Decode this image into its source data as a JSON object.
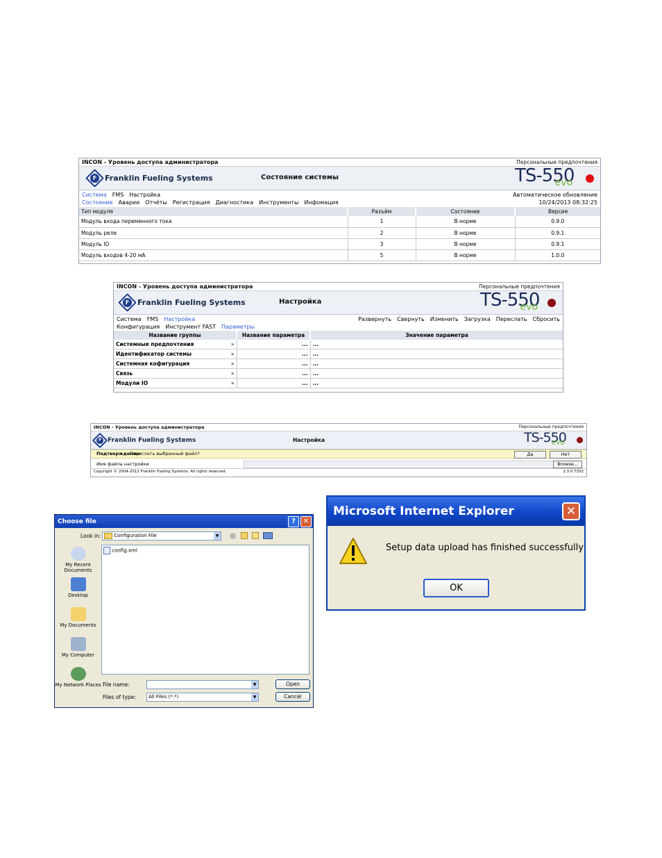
{
  "shot1": {
    "top_title": "INCON - Уровень доступа администратора",
    "pref": "Персональные предпочтения",
    "logo": "Franklin Fueling Systems",
    "header_title": "Состояние системы",
    "brand": "TS-550",
    "brand_sub": "evo",
    "menu1": [
      "Система",
      "FMS",
      "Настройка"
    ],
    "auto_update": "Автоматическое обновление",
    "menu2": [
      "Состояние",
      "Аварии",
      "Отчёты",
      "Регистрация",
      "Диагностика",
      "Инструменты",
      "Инфомация"
    ],
    "datetime": "10/24/2013 08:32:25",
    "columns": [
      "Тип модуля",
      "Разъём",
      "Состояние",
      "Версия"
    ],
    "rows": [
      [
        "Модуль входа переменного тока",
        "1",
        "В норме",
        "0.9.0"
      ],
      [
        "Модуль реле",
        "2",
        "В норме",
        "0.9.1"
      ],
      [
        "Модуль IO",
        "3",
        "В норме",
        "0.9.1"
      ],
      [
        "Модуль входов 4-20 мА",
        "5",
        "В норме",
        "1.0.0"
      ]
    ]
  },
  "shot2": {
    "top_title": "INCON - Уровень доступа администратора",
    "pref": "Персональные предпочтения",
    "logo": "Franklin Fueling Systems",
    "header_title": "Настройка",
    "brand": "TS-550",
    "brand_sub": "evo",
    "menu1": [
      "Система",
      "FMS",
      "Настройка"
    ],
    "actions": [
      "Развернуть",
      "Свернуть",
      "Изменить",
      "Загрузка",
      "Переслать",
      "Сбросить"
    ],
    "menu2": [
      "Конфигурация",
      "Инструмент FAST",
      "Параметры"
    ],
    "columns": [
      "Название группы",
      "Название параметра",
      "Значение параметра"
    ],
    "rows": [
      [
        "Системные предпочтения",
        "»",
        "...",
        "..."
      ],
      [
        "Идентификатор системы",
        "»",
        "...",
        "..."
      ],
      [
        "Системная кофигурация",
        "»",
        "...",
        "..."
      ],
      [
        "Связь",
        "»",
        "...",
        "..."
      ],
      [
        "Модули IO",
        "»",
        "...",
        "..."
      ]
    ]
  },
  "shot3": {
    "top_title": "INCON - Уровень доступа администратора",
    "pref": "Персональные предпочтения",
    "logo": "Franklin Fueling Systems",
    "header_title": "Настройка",
    "brand": "TS-550",
    "brand_sub": "evo",
    "confirm_label": "Подтверждение:",
    "confirm_text": "Переслать выбранный файл?",
    "yes": "Да",
    "no": "Нет",
    "file_label": "Имя файла настройки",
    "browse": "Browse...",
    "copyright": "Copyright © 2004-2012 Franklin Fueling Systems. All rights reserved.",
    "version": "2.3.0.7332"
  },
  "choose_file": {
    "title": "Choose file",
    "look_in_label": "Look in:",
    "look_in_value": "Configuration File",
    "places": [
      "My Recent Documents",
      "Desktop",
      "My Documents",
      "My Computer",
      "My Network Places"
    ],
    "file": "config.xml",
    "file_name_label": "File name:",
    "file_name_value": "",
    "files_type_label": "Files of type:",
    "files_type_value": "All Files (*.*)",
    "open": "Open",
    "cancel": "Cancel"
  },
  "ie_dialog": {
    "title": "Microsoft Internet Explorer",
    "message": "Setup data upload has finished successfully",
    "ok": "OK"
  },
  "colors": {
    "led_red": "#e01010",
    "led_dark": "#8b1010",
    "link": "#2f5bd6",
    "xp_blue": "#0d3fb4"
  }
}
